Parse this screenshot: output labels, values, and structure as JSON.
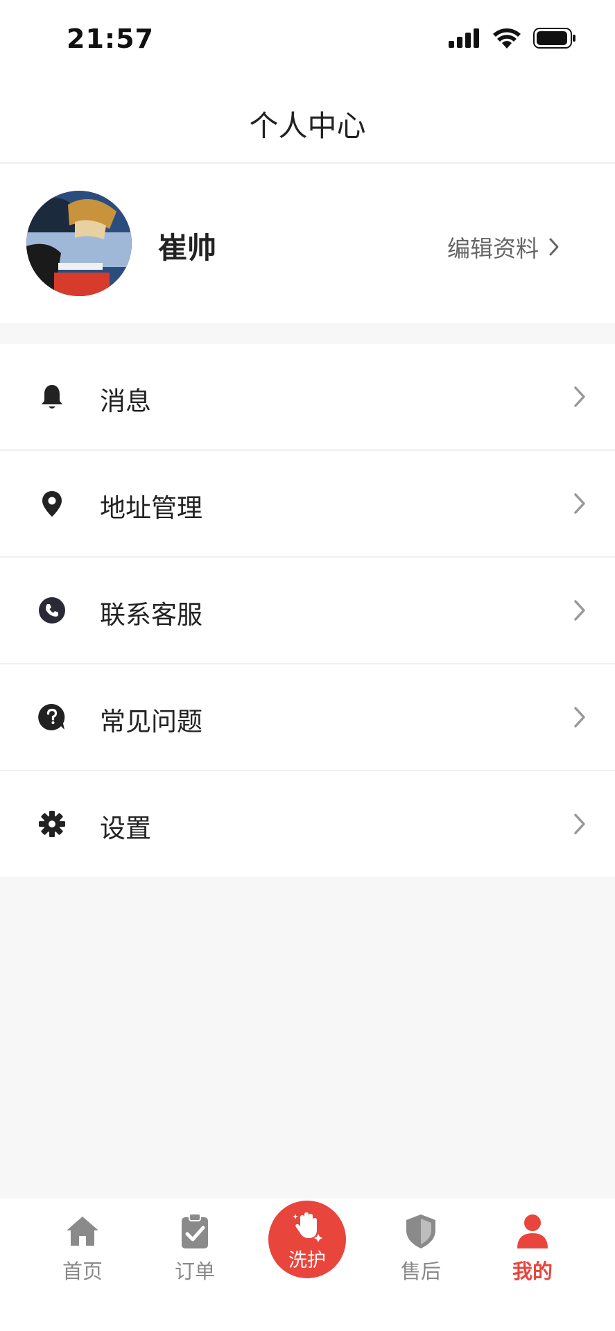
{
  "status_bar": {
    "time": "21:57",
    "icons": [
      "signal-icon",
      "wifi-icon",
      "battery-icon"
    ]
  },
  "header": {
    "title": "个人中心"
  },
  "profile": {
    "avatar_icon": "avatar",
    "name": "崔帅",
    "edit_label": "编辑资料"
  },
  "menu": {
    "items": [
      {
        "label": "消息",
        "icon": "bell-icon"
      },
      {
        "label": "地址管理",
        "icon": "location-pin-icon"
      },
      {
        "label": "联系客服",
        "icon": "phone-icon"
      },
      {
        "label": "常见问题",
        "icon": "question-icon"
      },
      {
        "label": "设置",
        "icon": "gear-icon"
      }
    ]
  },
  "tab_bar": {
    "tabs": [
      {
        "label": "首页",
        "icon": "home-icon"
      },
      {
        "label": "订单",
        "icon": "clipboard-check-icon"
      },
      {
        "label": "洗护",
        "icon": "hand-sparkle-icon"
      },
      {
        "label": "售后",
        "icon": "shield-icon"
      },
      {
        "label": "我的",
        "icon": "user-icon"
      }
    ],
    "active_index": 4
  },
  "colors": {
    "accent": "#e8453c",
    "text_primary": "#222222",
    "text_secondary": "#888888",
    "icon_dark": "#222222",
    "background": "#f7f7f7"
  }
}
